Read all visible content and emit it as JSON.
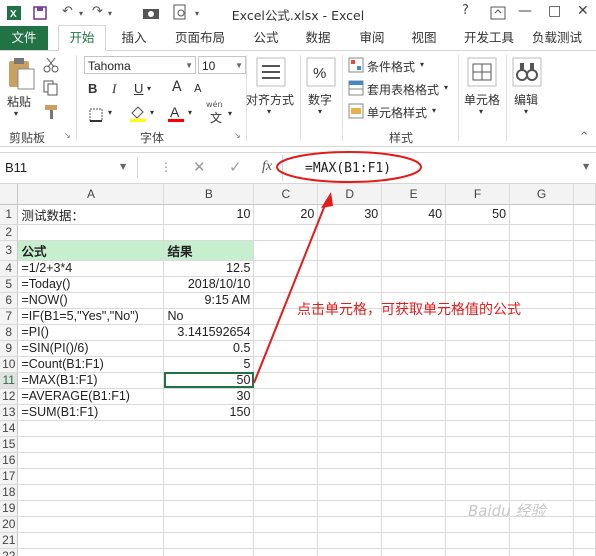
{
  "window": {
    "title": "Excel公式.xlsx - Excel",
    "help": "?",
    "minimize": "—",
    "restore": "□",
    "close": "✕"
  },
  "tabs": [
    "文件",
    "开始",
    "插入",
    "页面布局",
    "公式",
    "数据",
    "审阅",
    "视图",
    "开发工具",
    "负载测试"
  ],
  "ribbon": {
    "clipboard": {
      "paste": "粘贴",
      "label": "剪贴板"
    },
    "font": {
      "name": "Tahoma",
      "size": "10",
      "label": "字体",
      "bold": "B",
      "italic": "I",
      "underline": "U",
      "grow": "A",
      "shrink": "A",
      "fill_color": "#ffff00",
      "font_color": "#ff0000",
      "wen": "wén",
      "zi": "文"
    },
    "alignment": {
      "label": "对齐方式"
    },
    "number": {
      "label": "数字",
      "icon": "%"
    },
    "styles": {
      "cond": "条件格式",
      "table": "套用表格格式",
      "cell": "单元格样式",
      "label": "样式"
    },
    "cells": {
      "label": "单元格"
    },
    "editing": {
      "label": "编辑"
    }
  },
  "formula_bar": {
    "name_box": "B11",
    "fx": "fx",
    "cancel": "✕",
    "enter": "✓",
    "formula": "=MAX(B1:F1)"
  },
  "columns": [
    "A",
    "B",
    "C",
    "D",
    "E",
    "F",
    "G"
  ],
  "rows": [
    {
      "n": "1",
      "a": "测试数据：",
      "b": "10",
      "c": "20",
      "d": "30",
      "e": "40",
      "f": "50"
    },
    {
      "n": "2",
      "a": "",
      "b": ""
    },
    {
      "n": "3",
      "a": "公式",
      "b": "结果"
    },
    {
      "n": "4",
      "a": "=1/2+3*4",
      "b": "12.5"
    },
    {
      "n": "5",
      "a": "=Today()",
      "b": "2018/10/10"
    },
    {
      "n": "6",
      "a": "=NOW()",
      "b": "9:15 AM"
    },
    {
      "n": "7",
      "a": "=IF(B1=5,\"Yes\",\"No\")",
      "b": "No"
    },
    {
      "n": "8",
      "a": "=PI()",
      "b": "3.141592654"
    },
    {
      "n": "9",
      "a": "=SIN(PI()/6)",
      "b": "0.5"
    },
    {
      "n": "10",
      "a": "=Count(B1:F1)",
      "b": "5"
    },
    {
      "n": "11",
      "a": "=MAX(B1:F1)",
      "b": "50"
    },
    {
      "n": "12",
      "a": "=AVERAGE(B1:F1)",
      "b": "30"
    },
    {
      "n": "13",
      "a": "=SUM(B1:F1)",
      "b": "150"
    },
    {
      "n": "14"
    },
    {
      "n": "15"
    },
    {
      "n": "16"
    },
    {
      "n": "17"
    },
    {
      "n": "18"
    },
    {
      "n": "19"
    },
    {
      "n": "20"
    },
    {
      "n": "21"
    },
    {
      "n": "22"
    }
  ],
  "annotation": "点击单元格，可获取单元格值的公式",
  "watermark": "Bai du 经验"
}
